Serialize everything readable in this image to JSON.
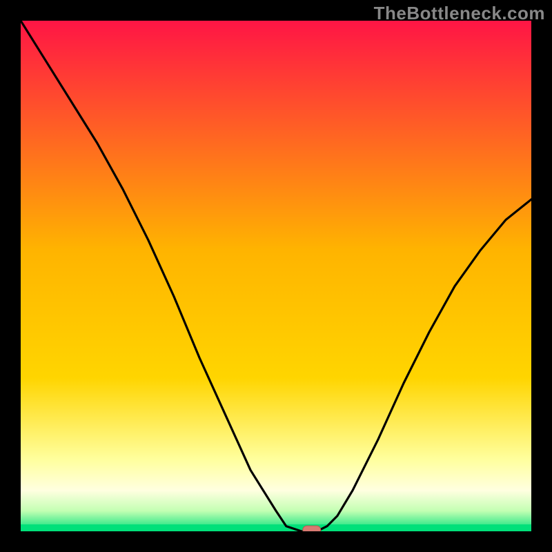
{
  "watermark": "TheBottleneck.com",
  "chart_data": {
    "type": "line",
    "title": "",
    "xlabel": "",
    "ylabel": "",
    "xlim": [
      0,
      100
    ],
    "ylim": [
      0,
      100
    ],
    "x": [
      0,
      5,
      10,
      15,
      20,
      25,
      30,
      35,
      40,
      45,
      50,
      52,
      55,
      58,
      60,
      62,
      65,
      70,
      75,
      80,
      85,
      90,
      95,
      100
    ],
    "values": [
      100,
      92,
      84,
      76,
      67,
      57,
      46,
      34,
      23,
      12,
      4,
      1,
      0,
      0,
      1,
      3,
      8,
      18,
      29,
      39,
      48,
      55,
      61,
      65
    ],
    "marker": {
      "x": 57,
      "y": 0
    },
    "colors": {
      "top": "#ff1545",
      "mid": "#ffd500",
      "paleGreen": "#c3ffb3",
      "green": "#00e07a",
      "curve": "#000000",
      "markerFill": "#d87a72",
      "markerStroke": "#b85a4e"
    }
  }
}
